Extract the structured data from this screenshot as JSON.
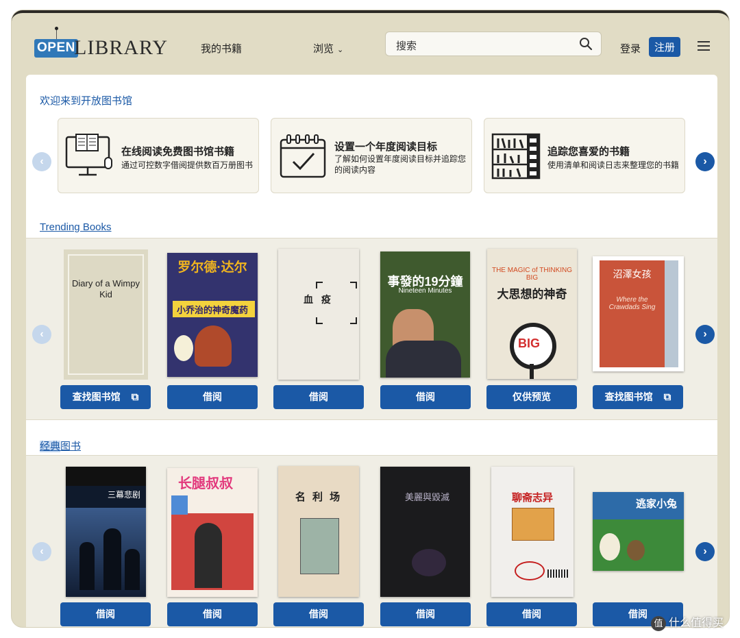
{
  "header": {
    "logo_open": "OPEN",
    "logo_library": "LIBRARY",
    "nav_my_books": "我的书籍",
    "nav_browse": "浏览",
    "search_placeholder": "搜索",
    "login": "登录",
    "signup": "注册"
  },
  "welcome": {
    "title": "欢迎来到开放图书馆",
    "cards": [
      {
        "icon": "computer-icon",
        "title": "在线阅读免费图书馆书籍",
        "desc": "通过可控数字借阅提供数百万册图书"
      },
      {
        "icon": "calendar-check-icon",
        "title": "设置一个年度阅读目标",
        "desc": "了解如何设置年度阅读目标并追踪您的阅读内容"
      },
      {
        "icon": "bookshelf-icon",
        "title": "追踪您喜爱的书籍",
        "desc": "使用清单和阅读日志来整理您的书籍"
      }
    ]
  },
  "trending": {
    "title": "Trending Books",
    "books": [
      {
        "cover_text": "Diary of a Wimpy Kid",
        "button": "查找图书馆",
        "external": true
      },
      {
        "cover_text": "罗尔德·达尔",
        "cover_subtext": "小乔治的神奇魔药",
        "button": "借阅"
      },
      {
        "cover_text": "血 疫",
        "button": "借阅"
      },
      {
        "cover_text": "事發的19分鐘",
        "cover_subtext": "Nineteen Minutes",
        "button": "借阅"
      },
      {
        "cover_text": "大思想的神奇",
        "cover_subtext": "THE MAGIC of THINKING BIG",
        "button": "仅供预览"
      },
      {
        "cover_text": "沼澤女孩",
        "cover_subtext": "Where the Crawdads Sing",
        "button": "查找图书馆",
        "external": true
      }
    ]
  },
  "classics": {
    "title_a": "经典",
    "title_b": "图书",
    "books": [
      {
        "cover_text": "三幕悲剧",
        "button": "借阅"
      },
      {
        "cover_text": "长腿叔叔",
        "button": "借阅"
      },
      {
        "cover_text": "名 利 场",
        "button": "借阅"
      },
      {
        "cover_text": "美麗與毀滅",
        "button": "借阅"
      },
      {
        "cover_text": "聊斋志异",
        "button": "借阅"
      },
      {
        "cover_text": "逃家小兔",
        "button": "借阅"
      }
    ]
  },
  "watermark": "什么值得买",
  "colors": {
    "accent": "#1b59a6",
    "header_bg": "#e1dcc5",
    "band_bg": "#f0eee5"
  }
}
